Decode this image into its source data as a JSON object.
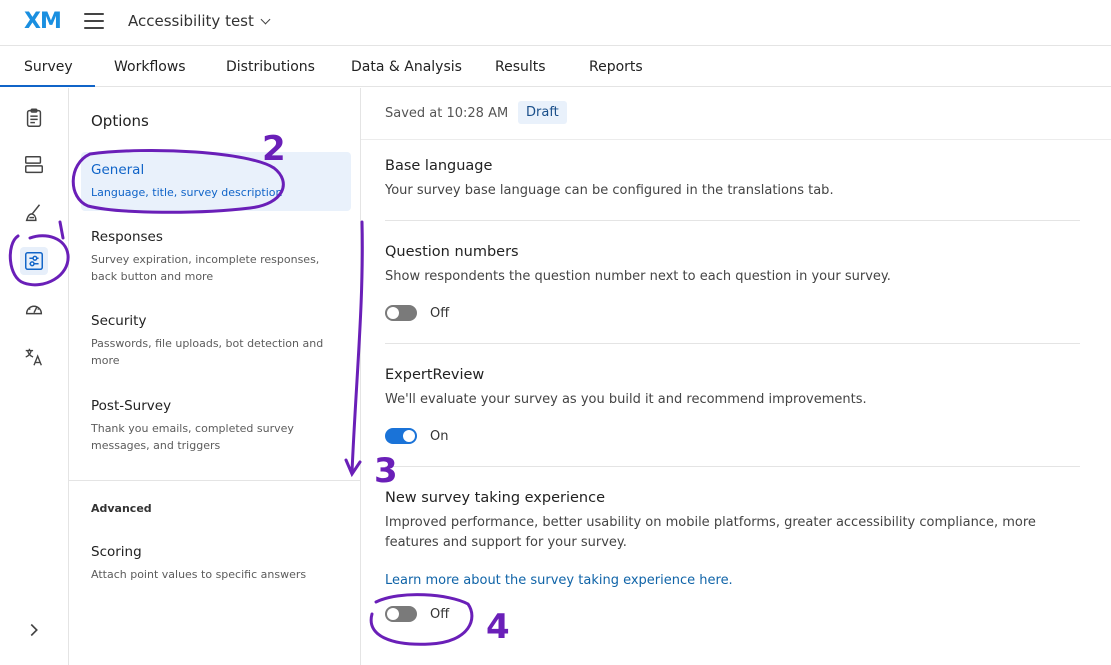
{
  "header": {
    "logo": "XM",
    "project_name": "Accessibility test"
  },
  "tabs": [
    {
      "label": "Survey",
      "active": true
    },
    {
      "label": "Workflows"
    },
    {
      "label": "Distributions"
    },
    {
      "label": "Data & Analysis"
    },
    {
      "label": "Results"
    },
    {
      "label": "Reports"
    }
  ],
  "rail": {
    "icons": [
      "survey-clipboard-icon",
      "survey-flow-icon",
      "look-and-feel-brush-icon",
      "survey-options-icon",
      "tools-gauge-icon",
      "translate-icon",
      "expand-chevron-icon"
    ],
    "active": "survey-options-icon"
  },
  "options": {
    "title": "Options",
    "items": [
      {
        "title": "General",
        "desc": "Language, title, survey description",
        "active": true
      },
      {
        "title": "Responses",
        "desc": "Survey expiration, incomplete responses, back button and more"
      },
      {
        "title": "Security",
        "desc": "Passwords, file uploads, bot detection and more"
      },
      {
        "title": "Post-Survey",
        "desc": "Thank you emails, completed survey messages, and triggers"
      }
    ],
    "advanced_label": "Advanced",
    "advanced_items": [
      {
        "title": "Scoring",
        "desc": "Attach point values to specific answers"
      }
    ]
  },
  "main": {
    "saved_text": "Saved at 10:28 AM",
    "status": "Draft",
    "sections": [
      {
        "title": "Base language",
        "desc": "Your survey base language can be configured in the translations tab."
      },
      {
        "title": "Question numbers",
        "desc": "Show respondents the question number next to each question in your survey.",
        "toggle": "Off",
        "on": false
      },
      {
        "title": "ExpertReview",
        "desc": "We'll evaluate your survey as you build it and recommend improvements.",
        "toggle": "On",
        "on": true
      },
      {
        "title": "New survey taking experience",
        "desc": "Improved performance, better usability on mobile platforms, greater accessibility compliance, more features and support for your survey.",
        "link": "Learn more about the survey taking experience here.",
        "toggle": "Off",
        "on": false
      }
    ]
  },
  "annotations": {
    "color": "#6a1fb8",
    "labels": [
      "1",
      "2",
      "3",
      "4"
    ]
  }
}
